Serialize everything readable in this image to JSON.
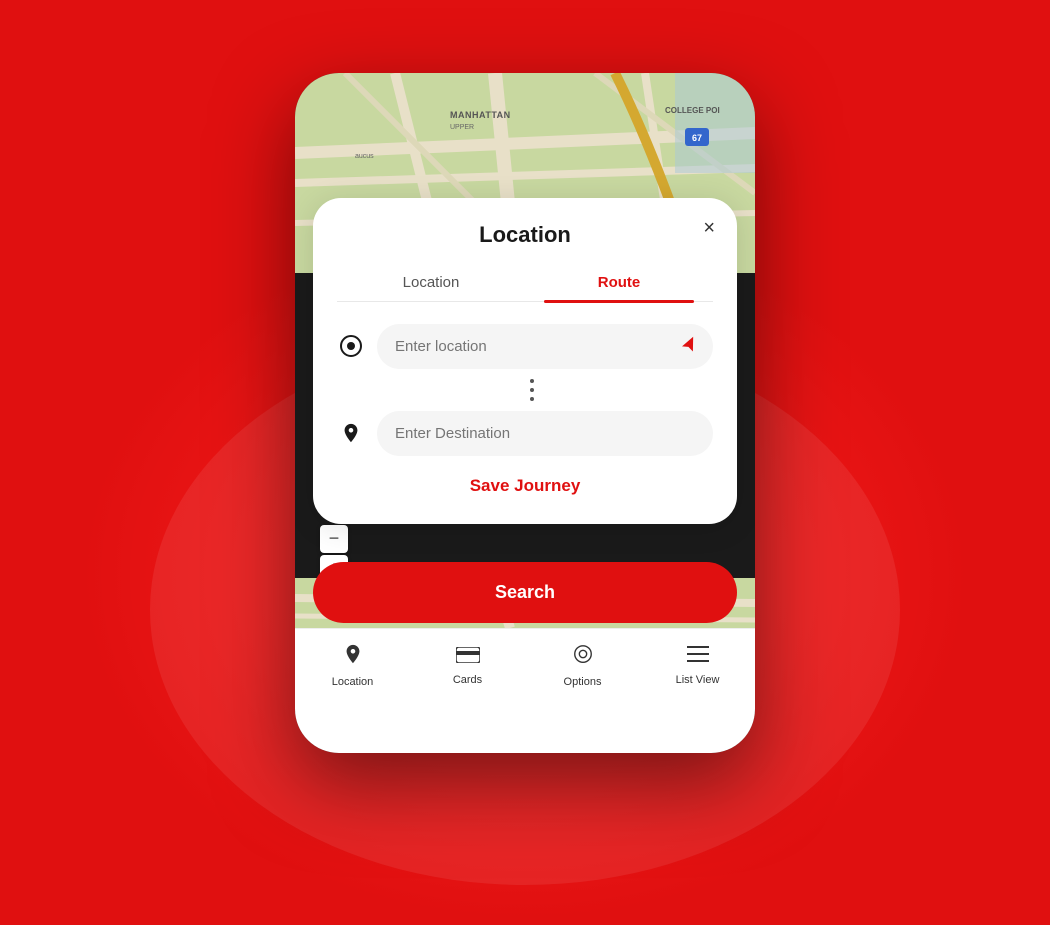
{
  "app": {
    "title": "Location"
  },
  "tabs": [
    {
      "id": "location",
      "label": "Location",
      "active": false
    },
    {
      "id": "route",
      "label": "Route",
      "active": true
    }
  ],
  "inputs": {
    "location": {
      "placeholder": "Enter location"
    },
    "destination": {
      "placeholder": "Enter Destination"
    }
  },
  "buttons": {
    "save_journey": "Save Journey",
    "search": "Search",
    "close": "×"
  },
  "bottom_nav": [
    {
      "id": "location",
      "label": "Location",
      "icon": "📍"
    },
    {
      "id": "cards",
      "label": "Cards",
      "icon": "💳"
    },
    {
      "id": "options",
      "label": "Options",
      "icon": "🎯"
    },
    {
      "id": "list-view",
      "label": "List View",
      "icon": "☰"
    }
  ],
  "map_controls": {
    "minus": "−",
    "plus": "+"
  },
  "colors": {
    "accent": "#e01010",
    "tab_active": "#e01010",
    "background": "#e01010"
  }
}
